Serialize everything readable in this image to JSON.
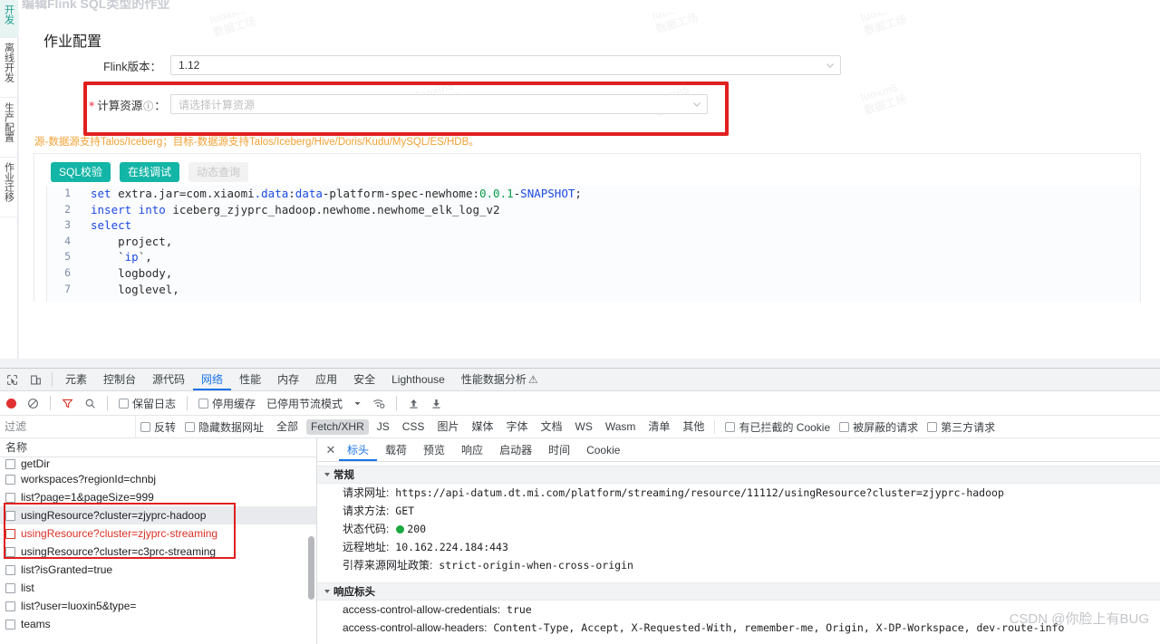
{
  "app": {
    "cut_title": "编辑Flink SQL类型的作业",
    "side_rail": [
      {
        "label": "开发",
        "active": true
      },
      {
        "label": "离线开发",
        "active": false
      },
      {
        "label": "生产配置",
        "active": false
      },
      {
        "label": "作业迁移",
        "active": false
      }
    ],
    "card_title": "作业配置",
    "form": {
      "flink_version_label": "Flink版本：",
      "flink_version_value": "1.12",
      "resource_label": "计算资源",
      "resource_label_suffix": "：",
      "resource_required_mark": "*",
      "resource_info_icon": "ⓘ",
      "resource_placeholder": "请选择计算资源"
    },
    "hint_text": "源-数据源支持Talos/Iceberg；目标-数据源支持Talos/Iceberg/Hive/Doris/Kudu/MySQL/ES/HDB。",
    "buttons": {
      "sql_check": "SQL校验",
      "online_debug": "在线调试",
      "dynamic_query": "动态查询"
    },
    "code_lines": [
      {
        "no": "1",
        "text": "set extra.jar=com.xiaomi.data:data-platform-spec-newhome:0.0.1-SNAPSHOT;"
      },
      {
        "no": "2",
        "text": "insert into iceberg_zjyprc_hadoop.newhome.newhome_elk_log_v2"
      },
      {
        "no": "3",
        "text": "select"
      },
      {
        "no": "4",
        "text": "    project,"
      },
      {
        "no": "5",
        "text": "    `ip`,"
      },
      {
        "no": "6",
        "text": "    logbody,"
      },
      {
        "no": "7",
        "text": "    loglevel,"
      }
    ],
    "watermark_line1": "luoxin5",
    "watermark_line2": "数据工场",
    "accent_color": "#13b5a6",
    "highlight_color": "#e01f1f",
    "hint_color": "#f0a135"
  },
  "devtools": {
    "tabs": [
      {
        "label": "元素",
        "active": false
      },
      {
        "label": "控制台",
        "active": false
      },
      {
        "label": "源代码",
        "active": false
      },
      {
        "label": "网络",
        "active": true
      },
      {
        "label": "性能",
        "active": false
      },
      {
        "label": "内存",
        "active": false
      },
      {
        "label": "应用",
        "active": false
      },
      {
        "label": "安全",
        "active": false
      },
      {
        "label": "Lighthouse",
        "active": false
      },
      {
        "label": "性能数据分析",
        "active": false
      }
    ],
    "warn_badge": "⚠",
    "toolbar": {
      "record": "record-button",
      "clear": "clear-button",
      "filter": "filter-button",
      "search": "search-button",
      "preserve_log": "保留日志",
      "disable_cache": "停用缓存",
      "throttling": "已停用节流模式",
      "import": "import-har",
      "export": "export-har"
    },
    "filterbar": {
      "filter_placeholder": "过滤",
      "invert": "反转",
      "hide_data_urls": "隐藏数据网址",
      "types": [
        {
          "label": "全部",
          "sel": false
        },
        {
          "label": "Fetch/XHR",
          "sel": true
        },
        {
          "label": "JS",
          "sel": false
        },
        {
          "label": "CSS",
          "sel": false
        },
        {
          "label": "图片",
          "sel": false
        },
        {
          "label": "媒体",
          "sel": false
        },
        {
          "label": "字体",
          "sel": false
        },
        {
          "label": "文档",
          "sel": false
        },
        {
          "label": "WS",
          "sel": false
        },
        {
          "label": "Wasm",
          "sel": false
        },
        {
          "label": "清单",
          "sel": false
        },
        {
          "label": "其他",
          "sel": false
        }
      ],
      "blocked_cookies": "有已拦截的 Cookie",
      "blocked_requests": "被屏蔽的请求",
      "third_party": "第三方请求"
    },
    "list_header": "名称",
    "requests": [
      {
        "name": "getDir",
        "sel": false,
        "err": false
      },
      {
        "name": "workspaces?regionId=chnbj",
        "sel": false,
        "err": false
      },
      {
        "name": "list?page=1&pageSize=999",
        "sel": false,
        "err": false
      },
      {
        "name": "usingResource?cluster=zjyprc-hadoop",
        "sel": true,
        "err": false
      },
      {
        "name": "usingResource?cluster=zjyprc-streaming",
        "sel": false,
        "err": true
      },
      {
        "name": "usingResource?cluster=c3prc-streaming",
        "sel": false,
        "err": false
      },
      {
        "name": "list?isGranted=true",
        "sel": false,
        "err": false
      },
      {
        "name": "list",
        "sel": false,
        "err": false
      },
      {
        "name": "list?user=luoxin5&type=",
        "sel": false,
        "err": false
      },
      {
        "name": "teams",
        "sel": false,
        "err": false
      }
    ],
    "detail_tabs": [
      {
        "label": "标头",
        "active": true
      },
      {
        "label": "载荷",
        "active": false
      },
      {
        "label": "预览",
        "active": false
      },
      {
        "label": "响应",
        "active": false
      },
      {
        "label": "启动器",
        "active": false
      },
      {
        "label": "时间",
        "active": false
      },
      {
        "label": "Cookie",
        "active": false
      }
    ],
    "general_section": "常规",
    "general": [
      {
        "key": "请求网址:",
        "value": "https://api-datum.dt.mi.com/platform/streaming/resource/11112/usingResource?cluster=zjyprc-hadoop",
        "status": false
      },
      {
        "key": "请求方法:",
        "value": "GET",
        "status": false
      },
      {
        "key": "状态代码:",
        "value": "200",
        "status": true
      },
      {
        "key": "远程地址:",
        "value": "10.162.224.184:443",
        "status": false
      },
      {
        "key": "引荐来源网址政策:",
        "value": "strict-origin-when-cross-origin",
        "status": false
      }
    ],
    "response_section": "响应标头",
    "response_headers": [
      {
        "key": "access-control-allow-credentials:",
        "value": "true"
      },
      {
        "key": "access-control-allow-headers:",
        "value": "Content-Type, Accept, X-Requested-With, remember-me, Origin, X-DP-Workspace, dev-route-info"
      }
    ],
    "csdn_watermark": "CSDN @你脸上有BUG"
  }
}
